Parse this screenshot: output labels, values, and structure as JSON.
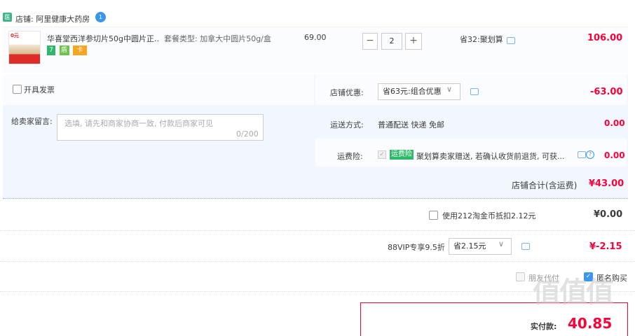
{
  "shop": {
    "badge": "医",
    "label": "店铺: 阿里健康大药房",
    "ww_badge": "1"
  },
  "item": {
    "thumb_text": "0元",
    "title": "华喜堂西洋参切片50g中圆片正...",
    "sku": "套餐类型: 加拿大中圆片50g/盒",
    "badges": [
      {
        "text": "7",
        "color": "#2eb86a"
      },
      {
        "text": "盾",
        "color": "#6cc24a"
      },
      {
        "text": "卡",
        "color": "#f5a623"
      }
    ],
    "price": "69.00",
    "qty_minus": "−",
    "qty": "2",
    "qty_plus": "+",
    "discount": "省32:聚划算",
    "total": "106.00"
  },
  "invoice": {
    "label": "开具发票"
  },
  "message": {
    "label": "给卖家留言:",
    "placeholder": "选填, 请先和商家协商一致, 付款后商家可见",
    "count": "0/200"
  },
  "coupon": {
    "label": "店铺优惠:",
    "selected": "省63元:组合优惠",
    "amount": "-63.00"
  },
  "shipping": {
    "label": "运送方式:",
    "value": "普通配送 快递 免邮",
    "amount": "0.00"
  },
  "insurance": {
    "label": "运费险:",
    "tag": "运费险",
    "text": "聚划算卖家赠送, 若确认收货前退货, 可获...",
    "amount": "0.00"
  },
  "shop_total": {
    "label": "店铺合计(含运费)",
    "amount": "¥43.00"
  },
  "coins": {
    "label": "使用212淘金币抵扣2.12元",
    "amount": "¥0.00"
  },
  "vip": {
    "label": "88VIP专享9.5折",
    "selected": "省2.15元",
    "amount": "¥-2.15"
  },
  "friend_pay": {
    "label": "朋友代付"
  },
  "anonymous": {
    "label": "匿名购买"
  },
  "payment": {
    "label": "实付款:",
    "amount": "40.85"
  },
  "watermark": "值值值",
  "colors": {
    "accent": "#ff0036",
    "blue": "#3b96ee",
    "panel": "#f2f7ff"
  }
}
